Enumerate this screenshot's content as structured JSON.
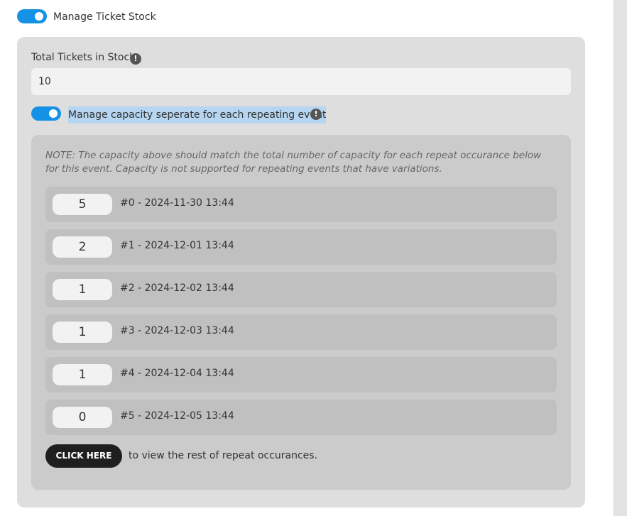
{
  "manage_stock": {
    "label": "Manage Ticket Stock",
    "enabled": true
  },
  "total_stock": {
    "label": "Total Tickets in Stock",
    "value": "10",
    "info_glyph": "!"
  },
  "separate_capacity": {
    "label": "Manage capacity seperate for each repeating event",
    "enabled": true,
    "info_glyph": "!"
  },
  "note": "NOTE: The capacity above should match the total number of capacity for each repeat occurance below for this event. Capacity is not supported for repeating events that have variations.",
  "occurrences": [
    {
      "capacity": "5",
      "label": "#0 - 2024-11-30 13:44"
    },
    {
      "capacity": "2",
      "label": "#1 - 2024-12-01 13:44"
    },
    {
      "capacity": "1",
      "label": "#2 - 2024-12-02 13:44"
    },
    {
      "capacity": "1",
      "label": "#3 - 2024-12-03 13:44"
    },
    {
      "capacity": "1",
      "label": "#4 - 2024-12-04 13:44"
    },
    {
      "capacity": "0",
      "label": "#5 - 2024-12-05 13:44"
    }
  ],
  "view_more": {
    "button_label": "CLICK HERE",
    "text": "to view the rest of repeat occurances."
  },
  "colors": {
    "accent": "#1592e6",
    "selection": "#b5d5f0",
    "button": "#1f1f1f"
  }
}
